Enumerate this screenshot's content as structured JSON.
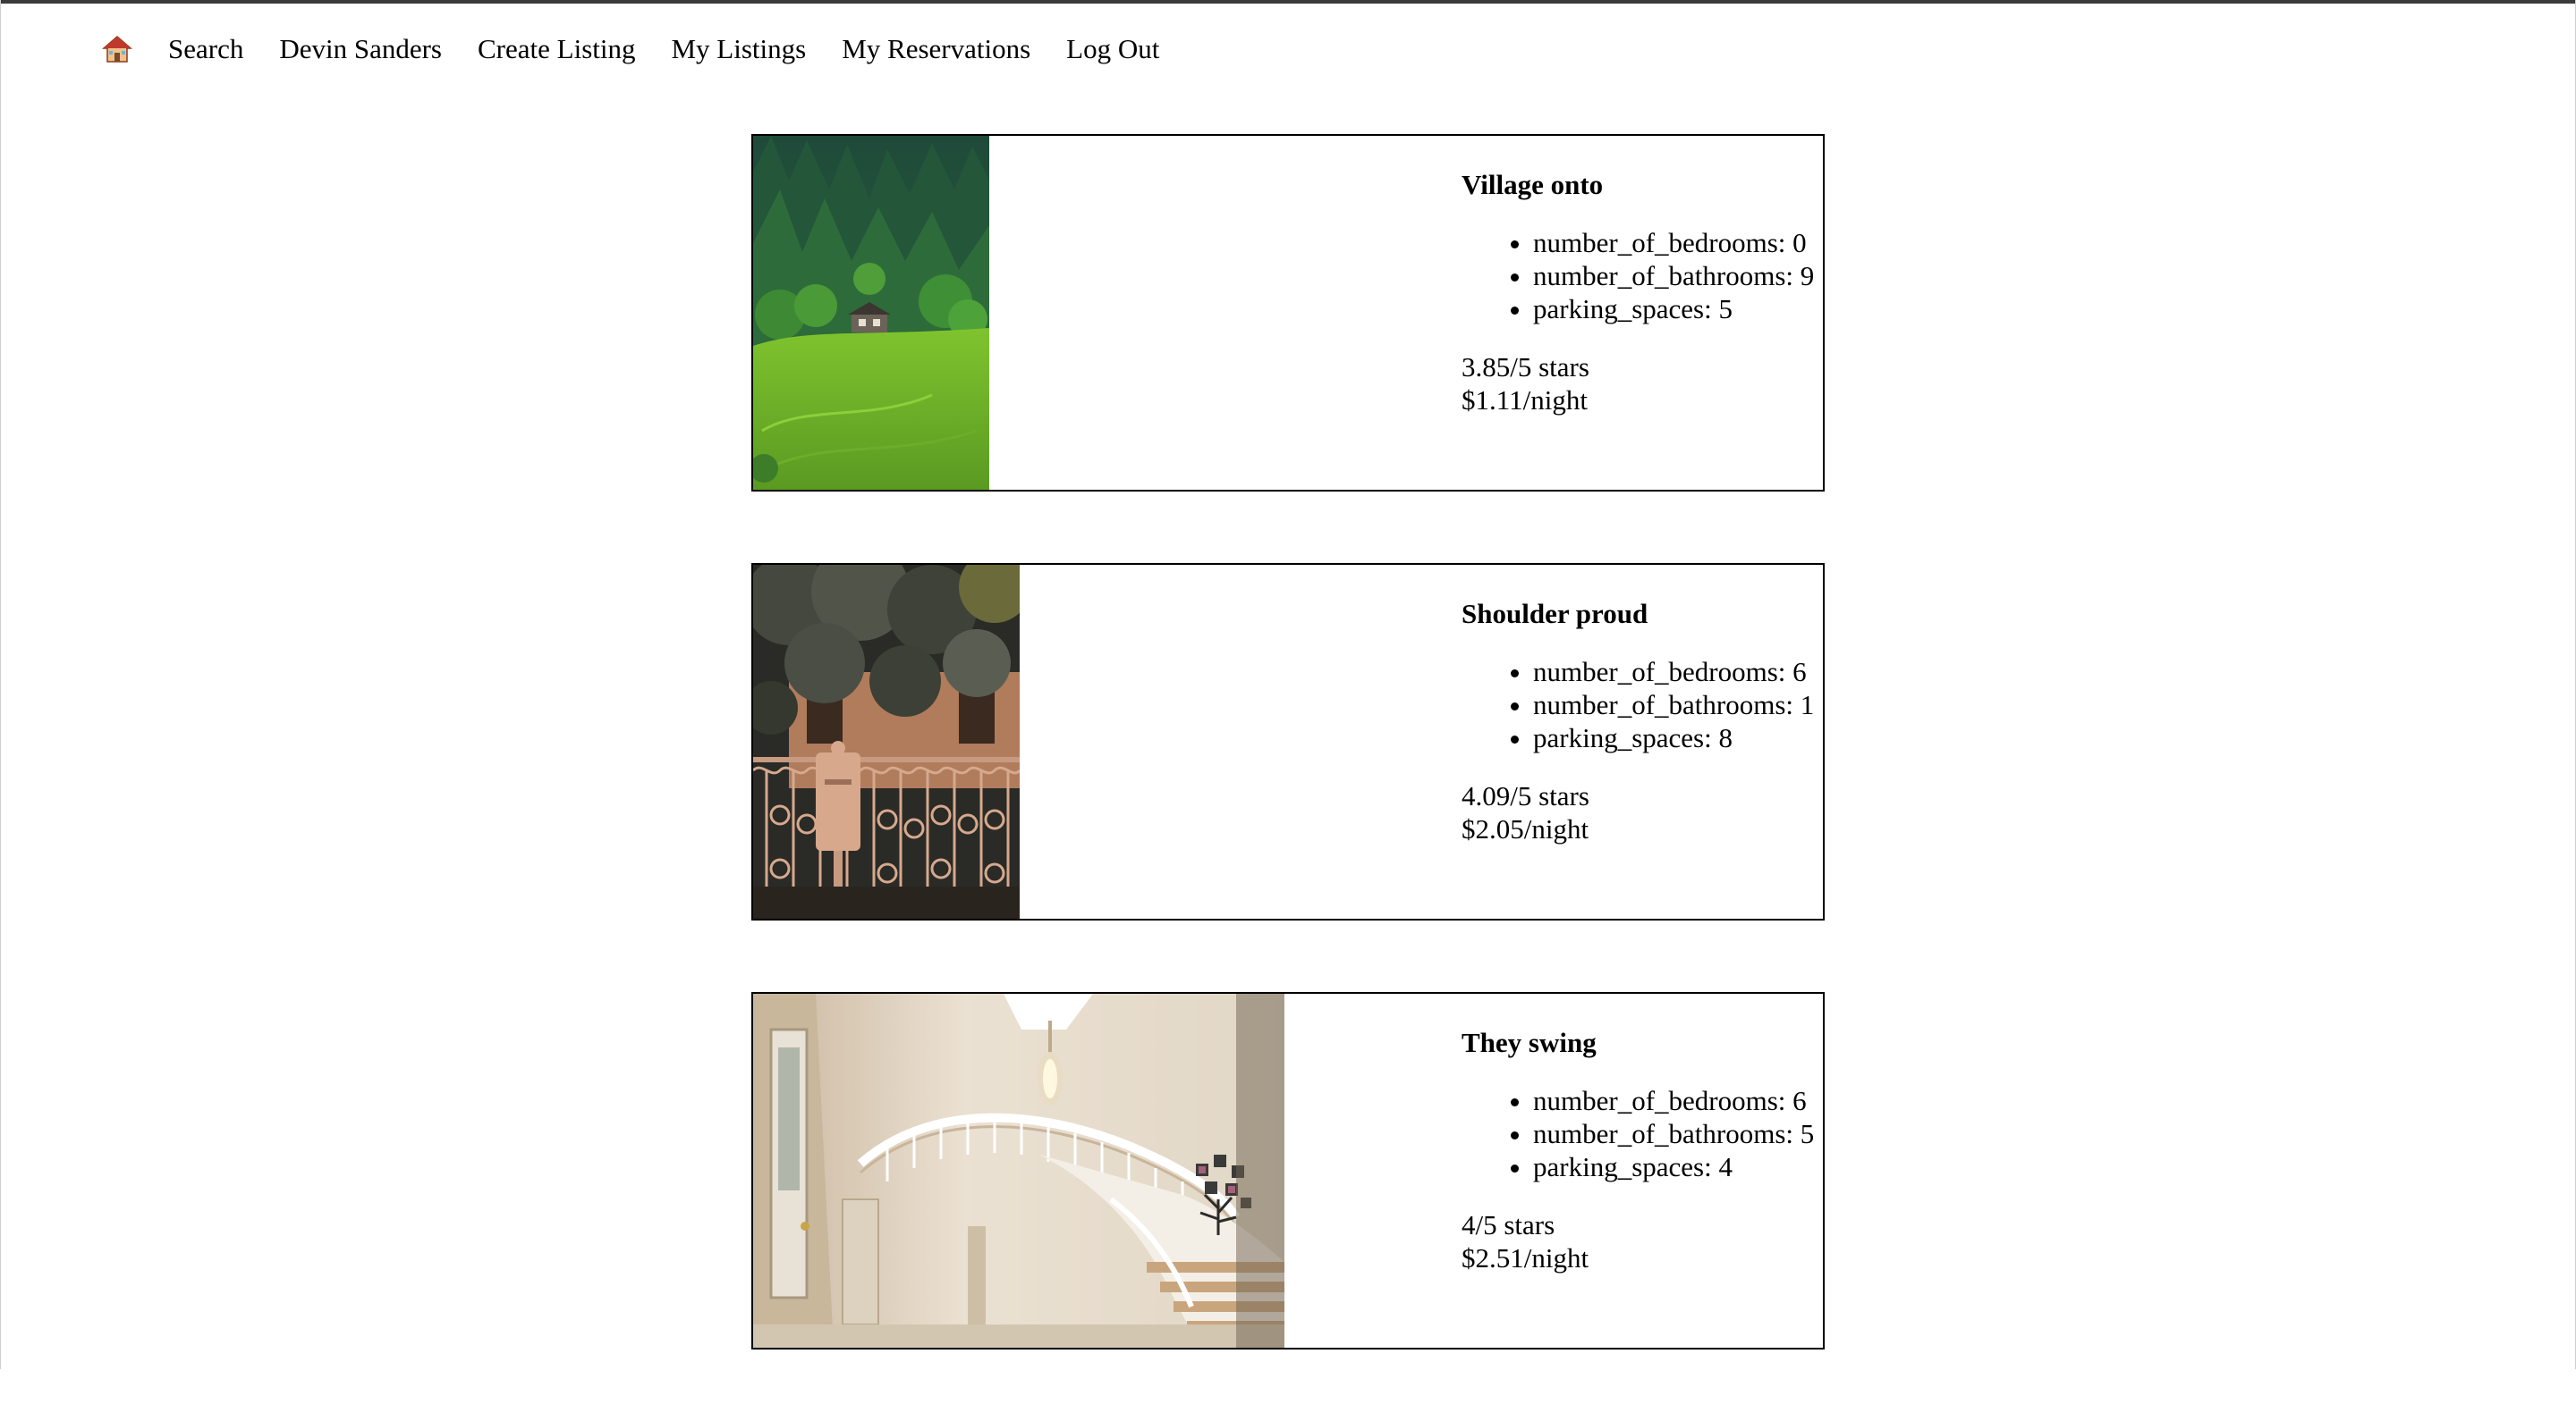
{
  "nav": {
    "home_icon": "house-emoji-icon",
    "links": [
      {
        "label": "Search"
      },
      {
        "label": "Devin Sanders"
      },
      {
        "label": "Create Listing"
      },
      {
        "label": "My Listings"
      },
      {
        "label": "My Reservations"
      },
      {
        "label": "Log Out"
      }
    ]
  },
  "listings": [
    {
      "title": "Village onto",
      "photo": "forest-hillside-cabin-photo",
      "attrs": [
        "number_of_bedrooms: 0",
        "number_of_bathrooms: 9",
        "parking_spaces: 5"
      ],
      "rating": "3.85/5 stars",
      "price": "$1.11/night"
    },
    {
      "title": "Shoulder proud",
      "photo": "ornate-gate-mailbox-photo",
      "attrs": [
        "number_of_bedrooms: 6",
        "number_of_bathrooms: 1",
        "parking_spaces: 8"
      ],
      "rating": "4.09/5 stars",
      "price": "$2.05/night"
    },
    {
      "title": "They swing",
      "photo": "spiral-staircase-foyer-photo",
      "attrs": [
        "number_of_bedrooms: 6",
        "number_of_bathrooms: 5",
        "parking_spaces: 4"
      ],
      "rating": "4/5 stars",
      "price": "$2.51/night"
    }
  ]
}
